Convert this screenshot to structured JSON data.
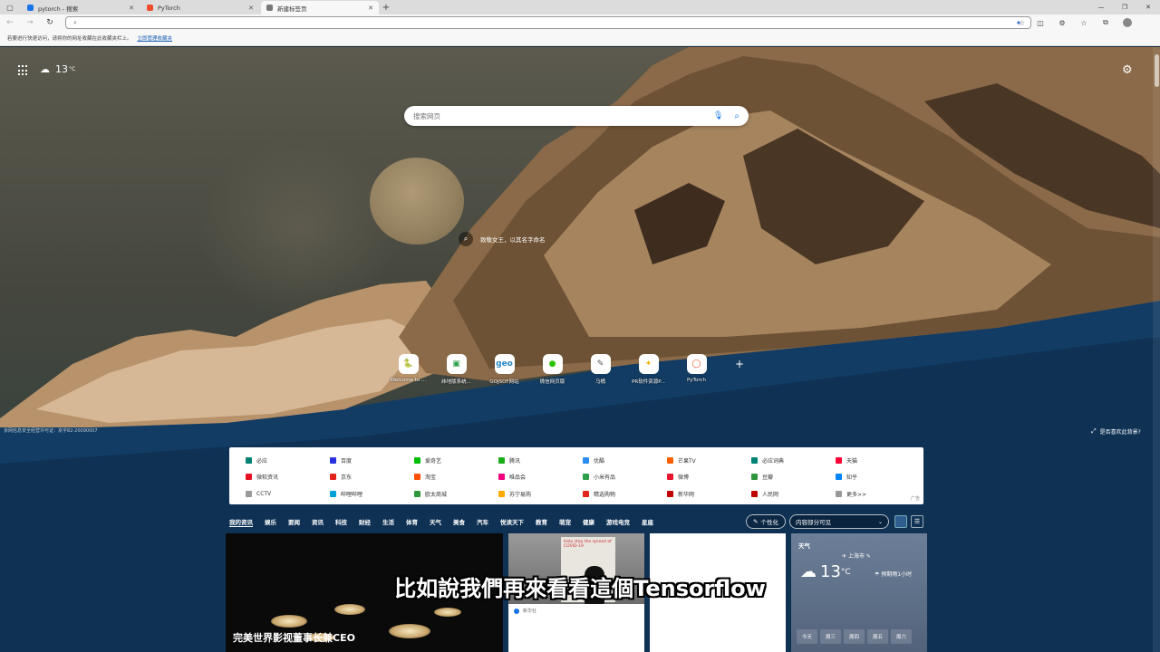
{
  "browser": {
    "tabs": [
      {
        "label": "pytorch - 搜索",
        "favicon_color": "#1a73e8",
        "active": false
      },
      {
        "label": "PyTorch",
        "favicon_color": "#ee4c2c",
        "active": false
      },
      {
        "label": "新建标签页",
        "favicon_color": "#777777",
        "active": true
      }
    ],
    "address": {
      "value": "",
      "placeholder": ""
    },
    "favorites_bar": {
      "hint": "若要进行快速访问，请将你的网址收藏在此收藏夹栏上。",
      "link": "立即管理收藏夹"
    }
  },
  "newtab": {
    "weather_temp": "13",
    "weather_unit": "°C",
    "search_placeholder": "搜索网页",
    "image_caption": "致敬女王，以其名字命名",
    "quick_links": [
      {
        "label": "Welcome to ...",
        "icon": "python-icon",
        "glyph": "🐍",
        "color": "#3776ab"
      },
      {
        "label": "纬地版系统...",
        "icon": "wd-icon",
        "glyph": "▣",
        "color": "#2e9e4a"
      },
      {
        "label": "GOJSOF网站",
        "icon": "geo-icon",
        "glyph": "geo",
        "color": "#2a88c8"
      },
      {
        "label": "微信网页版",
        "icon": "wechat-icon",
        "glyph": "●",
        "color": "#2dc100"
      },
      {
        "label": "马桶",
        "icon": "mascot-icon",
        "glyph": "✎",
        "color": "#555555"
      },
      {
        "label": "PR软件资源P...",
        "icon": "folder-icon",
        "glyph": "✦",
        "color": "#e8b400"
      },
      {
        "label": "PyTorch",
        "icon": "pytorch-icon",
        "glyph": "◯",
        "color": "#ee4c2c"
      }
    ],
    "footer_left": "京网信息安全经营许可证：京字82-20090007",
    "footer_right": "是否喜欢此背景?",
    "links_panel": {
      "rows": [
        [
          {
            "label": "必应",
            "color": "#008373"
          },
          {
            "label": "百度",
            "color": "#2932e1"
          },
          {
            "label": "爱奇艺",
            "color": "#00be06"
          },
          {
            "label": "腾讯",
            "color": "#1aad19"
          },
          {
            "label": "优酷",
            "color": "#2d8cf0"
          },
          {
            "label": "芒果TV",
            "color": "#ff5f00"
          },
          {
            "label": "必应词典",
            "color": "#008373"
          },
          {
            "label": "天猫",
            "color": "#ff0036"
          }
        ],
        [
          {
            "label": "微软资讯",
            "color": "#e81123"
          },
          {
            "label": "京东",
            "color": "#e1251b"
          },
          {
            "label": "淘宝",
            "color": "#ff5000"
          },
          {
            "label": "唯品会",
            "color": "#f10180"
          },
          {
            "label": "小米有品",
            "color": "#2e9e4a"
          },
          {
            "label": "微博",
            "color": "#e6162d"
          },
          {
            "label": "豆瓣",
            "color": "#2e963d"
          },
          {
            "label": "知乎",
            "color": "#0084ff"
          }
        ],
        [
          {
            "label": "CCTV",
            "color": "#999999"
          },
          {
            "label": "哔哩哔哩",
            "color": "#00a1d6"
          },
          {
            "label": "欧太商城",
            "color": "#2e963d"
          },
          {
            "label": "苏宁易购",
            "color": "#ffaa00"
          },
          {
            "label": "精选购物",
            "color": "#e1251b"
          },
          {
            "label": "新华网",
            "color": "#c00000"
          },
          {
            "label": "人民网",
            "color": "#c00000"
          },
          {
            "label": "更多>>",
            "color": "#999999"
          }
        ]
      ],
      "ad_label": "广告"
    },
    "feed_tabs": [
      "我的资讯",
      "娱乐",
      "要闻",
      "资讯",
      "科技",
      "财经",
      "生活",
      "体育",
      "天气",
      "美食",
      "汽车",
      "悦读天下",
      "教育",
      "萌宠",
      "健康",
      "游戏电竞",
      "星座"
    ],
    "personalize_label": "个性化",
    "content_visibility": "内容部分可见",
    "big_card_headline": "完美世界影视董事长兼CEO",
    "news_card": {
      "poster_text": "Help stop the spread of COVID-19",
      "source": "新华社"
    },
    "weather_card": {
      "title": "天气",
      "city": "上海市",
      "temp": "13",
      "unit": "°C",
      "rain": "预期雨1小时",
      "days": [
        "今天",
        "周三",
        "周四",
        "周五",
        "周六"
      ]
    }
  },
  "subtitle": "比如說我們再來看看這個Tensorflow"
}
